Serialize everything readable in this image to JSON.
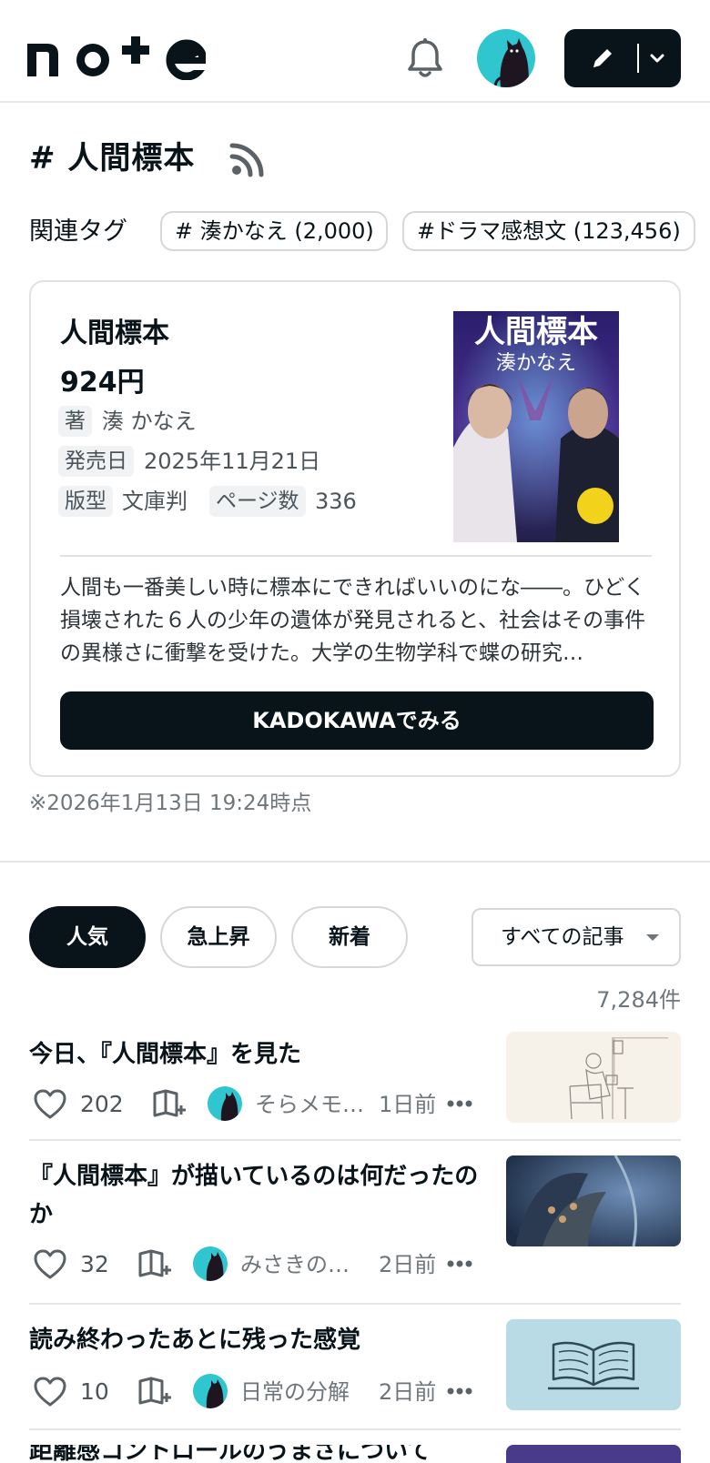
{
  "header": {
    "logo_text": "note",
    "logo_icon": "note-logo",
    "bell_icon": "bell-icon",
    "avatar_icon": "cat-avatar-icon",
    "post_button_icon": "pencil-icon",
    "post_dropdown_icon": "chevron-down-icon"
  },
  "tag": {
    "title": "# 人間標本",
    "rss_icon": "rss-icon"
  },
  "related": {
    "label": "関連タグ",
    "tags": [
      {
        "label": "# 湊かなえ (2,000)"
      },
      {
        "label": "#ドラマ感想文 (123,456)"
      }
    ]
  },
  "book": {
    "title": "人間標本",
    "price": "924円",
    "author_label": "著",
    "author": "湊 かなえ",
    "release_label": "発売日",
    "release": "2025年11月21日",
    "format_label": "版型",
    "format": "文庫判",
    "pages_label": "ページ数",
    "pages": "336",
    "description": "人間も一番美しい時に標本にできればいいのにな――。ひどく損壊された６人の少年の遺体が発見されると、社会はその事件の異様さに衝撃を受けた。大学の生物学科で蝶の研究…",
    "cover": {
      "title": "人間標本",
      "author": "湊かなえ"
    },
    "button_label": "KADOKAWAでみる",
    "as_of": "※2026年1月13日 19:24時点"
  },
  "filters": {
    "tabs": [
      {
        "label": "人気",
        "active": true
      },
      {
        "label": "急上昇",
        "active": false
      },
      {
        "label": "新着",
        "active": false
      }
    ],
    "select_value": "すべての記事",
    "count": "7,284件"
  },
  "articles": [
    {
      "title": "今日、『人間標本』を見た",
      "likes": "202",
      "author": "そらメモ…",
      "ago": "1日前",
      "thumb": "sketch-woman-reading"
    },
    {
      "title": "『人間標本』が描いているのは何だったのか",
      "likes": "32",
      "author": "みさきの…",
      "ago": "2日前",
      "thumb": "butterfly-photo"
    },
    {
      "title": "読み終わったあとに残った感覚",
      "likes": "10",
      "author": "日常の分解",
      "ago": "2日前",
      "thumb": "open-book-illustration"
    },
    {
      "title": "距離感コントロールのうまさについて",
      "thumb": "purple-image"
    }
  ],
  "colors": {
    "primary": "#08131a",
    "border": "#d4d8db",
    "muted": "#6e767b",
    "avatar_teal": "#2fc6cf"
  }
}
